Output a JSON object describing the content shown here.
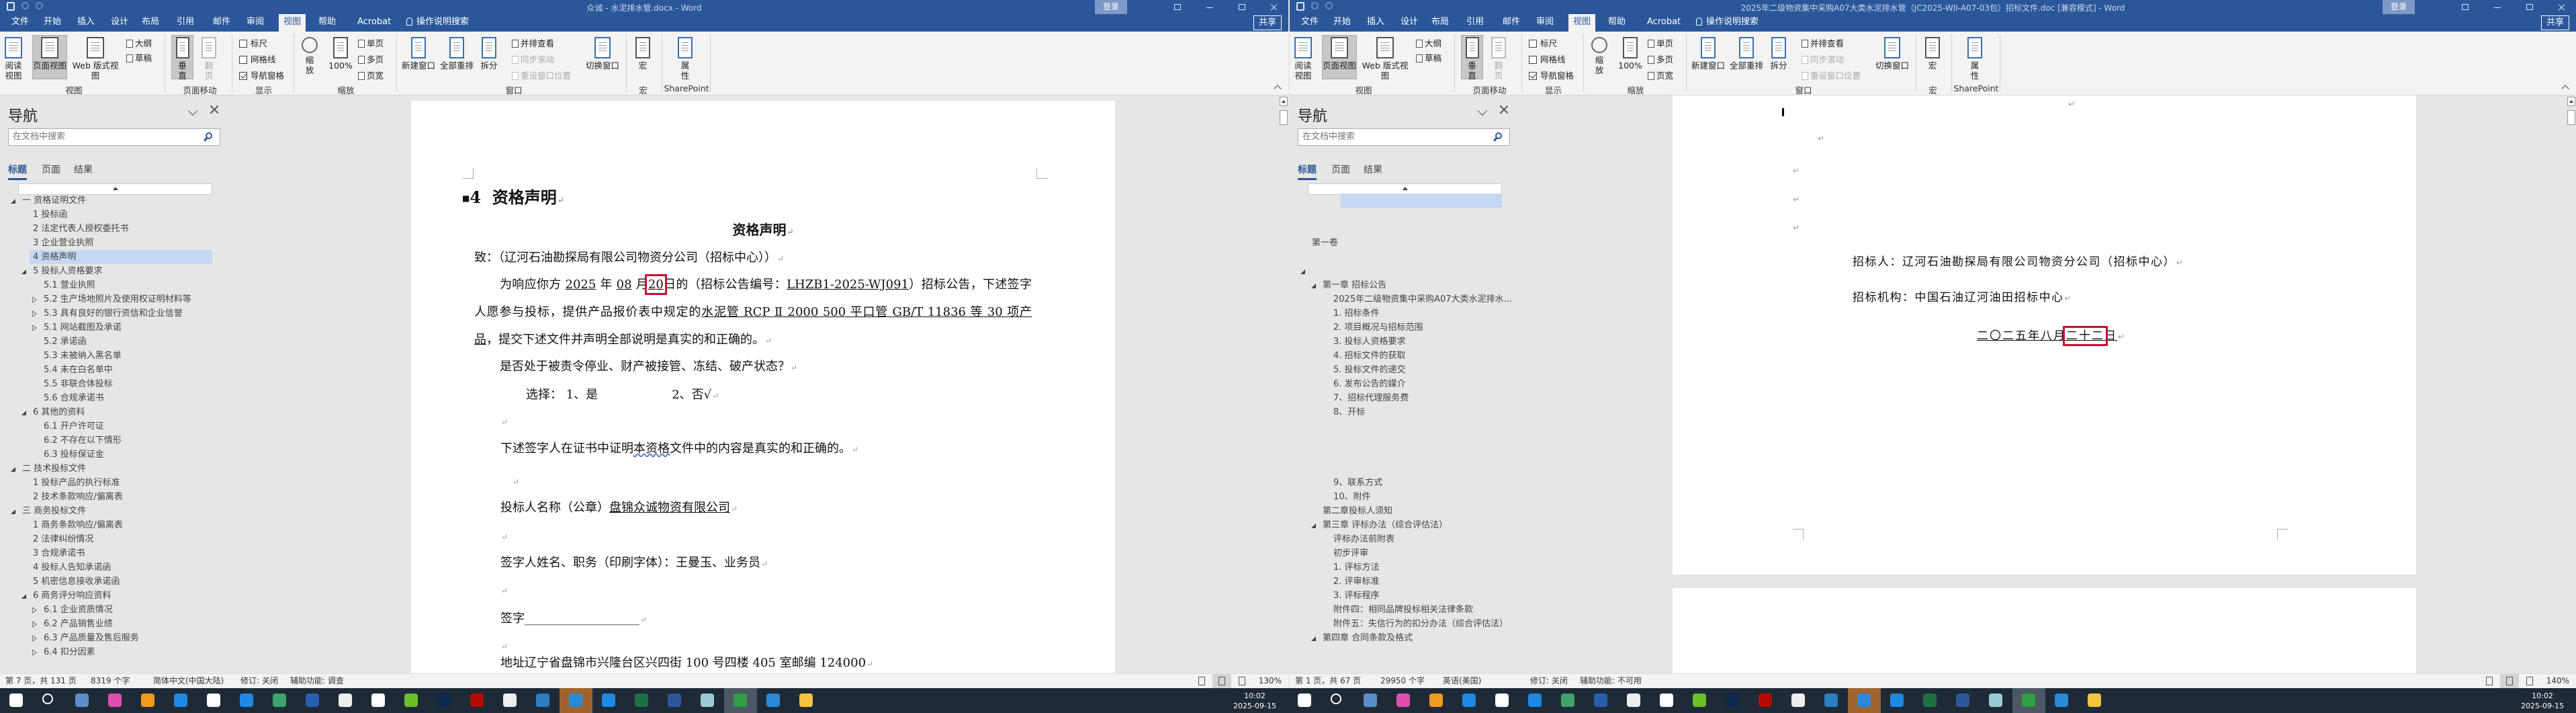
{
  "menu_tabs": [
    "文件",
    "开始",
    "插入",
    "设计",
    "布局",
    "引用",
    "邮件",
    "审阅",
    "视图",
    "帮助",
    "Acrobat"
  ],
  "active_tab": "视图",
  "tell_me": "操作说明搜索",
  "login": "登录",
  "share": "共享",
  "ribbon": {
    "read_mode": "阅读视图",
    "print_layout": "页面视图",
    "web_layout": "Web 版式视图",
    "outline": "大纲",
    "draft": "草稿",
    "vertical": "垂直",
    "side_to_side": "翻页",
    "ruler": "标尺",
    "gridlines": "网格线",
    "nav_pane": "导航窗格",
    "nav_pane_checked": true,
    "ruler_checked": false,
    "gridlines_checked": false,
    "zoom": "缩放",
    "zoom_100": "100%",
    "one_page": "单页",
    "multi_page": "多页",
    "page_width": "页宽",
    "new_window": "新建窗口",
    "arrange_all": "全部重排",
    "split": "拆分",
    "side_by_side": "并排查看",
    "sync_scroll": "同步滚动",
    "reset_position": "重设窗口位置",
    "switch_windows": "切换窗口",
    "macros": "宏",
    "properties": "属性",
    "groups": {
      "views": "视图",
      "page_movement": "页面移动",
      "show": "显示",
      "zoom": "缩放",
      "window": "窗口",
      "macros": "宏",
      "sharepoint": "SharePoint"
    }
  },
  "windows": [
    {
      "title": "众诚 - 水泥排水管.docx - Word",
      "nav": {
        "title": "导航",
        "search_placeholder": "在文档中搜索",
        "tabs": [
          "标题",
          "页面",
          "结果"
        ],
        "items": [
          {
            "label": "一 资格证明文件",
            "level": 0,
            "exp": "exp"
          },
          {
            "label": "1 投标函",
            "level": 1
          },
          {
            "label": "2 法定代表人授权委托书",
            "level": 1
          },
          {
            "label": "3 企业营业执照",
            "level": 1
          },
          {
            "label": "4 资格声明",
            "level": 1,
            "selected": true
          },
          {
            "label": "5 投标人资格要求",
            "level": 1,
            "exp": "exp"
          },
          {
            "label": "5.1 营业执照",
            "level": 2
          },
          {
            "label": "5.2 生产场地照片及使用权证明材料等",
            "level": 2,
            "exp": "col"
          },
          {
            "label": "5.3 具有良好的银行资信和企业信誉",
            "level": 2,
            "exp": "col"
          },
          {
            "label": "5.1 网站截图及承诺",
            "level": 2,
            "exp": "col"
          },
          {
            "label": "5.2 承诺函",
            "level": 2
          },
          {
            "label": "5.3 未被纳入黑名单",
            "level": 2
          },
          {
            "label": "5.4 未在白名单中",
            "level": 2
          },
          {
            "label": "5.5 非联合体投标",
            "level": 2
          },
          {
            "label": "5.6 合规承诺书",
            "level": 2
          },
          {
            "label": "6 其他的资料",
            "level": 1,
            "exp": "exp"
          },
          {
            "label": "6.1 开户许可证",
            "level": 2
          },
          {
            "label": "6.2 不存在以下情形",
            "level": 2
          },
          {
            "label": "6.3 投标保证金",
            "level": 2
          },
          {
            "label": "二 技术投标文件",
            "level": 0,
            "exp": "exp"
          },
          {
            "label": "1 投标产品的执行标准",
            "level": 1
          },
          {
            "label": "2 技术条款响应/偏离表",
            "level": 1
          },
          {
            "label": "三 商务投标文件",
            "level": 0,
            "exp": "exp"
          },
          {
            "label": "1 商务条款响应/偏离表",
            "level": 1
          },
          {
            "label": "2 法律纠纷情况",
            "level": 1
          },
          {
            "label": "3 合规承诺书",
            "level": 1
          },
          {
            "label": "4 投标人告知承诺函",
            "level": 1
          },
          {
            "label": "5 机密信息接收承诺函",
            "level": 1
          },
          {
            "label": "6 商务评分响应资料",
            "level": 1,
            "exp": "exp"
          },
          {
            "label": "6.1 企业资质情况",
            "level": 2,
            "exp": "col"
          },
          {
            "label": "6.2 产品销售业绩",
            "level": 2,
            "exp": "col"
          },
          {
            "label": "6.3 产品质量及售后服务",
            "level": 2,
            "exp": "col"
          },
          {
            "label": "6.4 扣分因素",
            "level": 2,
            "exp": "col"
          }
        ]
      },
      "status": {
        "page": "第 7 页，共 131 页",
        "words": "8319 个字",
        "lang": "简体中文(中国大陆)",
        "track": "修订: 关闭",
        "access": "辅助功能: 调查"
      },
      "zoom_level": "130%"
    },
    {
      "title": "2025年二级物资集中采购A07大类水泥排水管（JC2025-WII-A07-03包）招标文件.doc [兼容模式] - Word",
      "nav": {
        "title": "导航",
        "search_placeholder": "在文档中搜索",
        "tabs": [
          "标题",
          "页面",
          "结果"
        ],
        "items": [
          {
            "label": "",
            "level": 3,
            "selected": true
          },
          {
            "label": "",
            "level": 3
          },
          {
            "label": "",
            "level": 3
          },
          {
            "label": "第一卷",
            "level": 0
          },
          {
            "label": "",
            "level": 0
          },
          {
            "label": "",
            "level": 0,
            "exp": "exp"
          },
          {
            "label": "第一章  招标公告",
            "level": 1,
            "exp": "exp"
          },
          {
            "label": "2025年二级物资集中采购A07大类水泥排水...",
            "level": 2
          },
          {
            "label": "1. 招标条件",
            "level": 2
          },
          {
            "label": "2. 项目概况与招标范围",
            "level": 2
          },
          {
            "label": "3. 投标人资格要求",
            "level": 2
          },
          {
            "label": "4. 招标文件的获取",
            "level": 2
          },
          {
            "label": "5. 投标文件的递交",
            "level": 2
          },
          {
            "label": "6. 发布公告的媒介",
            "level": 2
          },
          {
            "label": "7、招标代理服务费",
            "level": 2
          },
          {
            "label": "8、开标",
            "level": 2
          },
          {
            "label": "",
            "level": 2
          },
          {
            "label": "",
            "level": 2
          },
          {
            "label": "",
            "level": 2
          },
          {
            "label": "",
            "level": 2
          },
          {
            "label": "9、联系方式",
            "level": 2
          },
          {
            "label": "10、附件",
            "level": 2
          },
          {
            "label": "第二章投标人须知",
            "level": 1
          },
          {
            "label": "第三章  评标办法（综合评估法）",
            "level": 1,
            "exp": "exp"
          },
          {
            "label": "评标办法前附表",
            "level": 2
          },
          {
            "label": "初步评审",
            "level": 2
          },
          {
            "label": "1. 评标方法",
            "level": 2
          },
          {
            "label": "2. 评审标准",
            "level": 2
          },
          {
            "label": "3. 评标程序",
            "level": 2
          },
          {
            "label": "附件四：相同品牌投标相关法律条款",
            "level": 2
          },
          {
            "label": "附件五：失信行为的扣分办法（综合评估法）",
            "level": 2
          },
          {
            "label": "第四章  合同条款及格式",
            "level": 1,
            "exp": "exp"
          }
        ]
      },
      "status": {
        "page": "第 1 页，共 67 页",
        "words": "29950 个字",
        "lang": "英语(美国)",
        "track": "修订: 关闭",
        "access": "辅助功能: 不可用"
      },
      "zoom_level": "140%"
    }
  ],
  "left_doc": {
    "heading_number": "4",
    "heading": "资格声明",
    "title": "资格声明",
    "to": "致：（辽河石油勘探局有限公司物资分公司（招标中心））",
    "p_intro": [
      "为响应你方 ",
      "2025",
      " 年 ",
      "08",
      " 月",
      "20",
      "日的（招标公告编号：",
      "LHZB1-2025-WJ091",
      "）招标公告，下述签字人愿参与投标，提供产品报价表中规定的",
      "水泥管 RCP Ⅱ 2000 500 平口管 GB/T 11836 等 30 项产品",
      "，提交下述文件并声明全部说明是真实的和正确的。"
    ],
    "question": "是否处于被责令停业、财产被接管、冻结、破产状态？",
    "choice_label": "选择： 1、是",
    "choice_no": "2、否√",
    "certify": [
      "下述签字人在证书中证明",
      "本资格",
      "文件中的内容是真实的和正确的。"
    ],
    "bidder_label": "投标人名称（公章）",
    "bidder_name": "盘锦众诚物资有限公司",
    "signer": "签字人姓名、职务（印刷字体）：王曼玉、业务员",
    "signature": "签字___________________",
    "address": "地址辽宁省盘锦市兴隆台区兴四街 100 号四楼 405 室邮编 124000"
  },
  "right_doc": {
    "tenderer": "招标人：辽河石油勘探局有限公司物资分公司（招标中心）",
    "agency": "招标机构：中国石油辽河油田招标中心",
    "date_prefix": "二〇二五年八月",
    "date_day": "二十二",
    "date_suffix": "日"
  },
  "taskbar": {
    "time": "10:02",
    "date": "2025-09-15",
    "icons": [
      {
        "name": "windows-start-icon",
        "color": "#ffffff"
      },
      {
        "name": "search-icon",
        "color": "#ffffff"
      },
      {
        "name": "calculator-icon",
        "color": "#5b8fc9"
      },
      {
        "name": "color-wheel-app-icon",
        "color": "#e04fb0"
      },
      {
        "name": "camera-app-icon",
        "color": "#f39a1e"
      },
      {
        "name": "dots-app-icon",
        "color": "#1e88e5"
      },
      {
        "name": "tencent-app-icon",
        "color": "#ffffff"
      },
      {
        "name": "browser-360-icon",
        "color": "#1e88e5"
      },
      {
        "name": "sync-app-icon",
        "color": "#3fa36b"
      },
      {
        "name": "ie-app-icon",
        "color": "#2a5db0"
      },
      {
        "name": "document-app-icon",
        "color": "#eeeeee"
      },
      {
        "name": "blank-file-icon",
        "color": "#ffffff"
      },
      {
        "name": "green-app-icon",
        "color": "#6bbf2a"
      },
      {
        "name": "photoshop-icon",
        "color": "#0a2a4d"
      },
      {
        "name": "acrobat-icon",
        "color": "#b30b00"
      },
      {
        "name": "qq-icon",
        "color": "#eeeeee"
      },
      {
        "name": "xiu-app-icon",
        "color": "#2a7fc1"
      },
      {
        "name": "orange-active-app-icon",
        "color": "#2a8ad8",
        "active": "active"
      },
      {
        "name": "blue-c-app-icon",
        "color": "#1e88e5"
      },
      {
        "name": "excel-icon",
        "color": "#1d7044"
      },
      {
        "name": "word-icon",
        "color": "#2b579a"
      },
      {
        "name": "glass-app-icon",
        "color": "#9cc9d9"
      },
      {
        "name": "green-s-app-icon",
        "color": "#2f9e44",
        "active": "active2"
      },
      {
        "name": "blue-doc-app-icon",
        "color": "#2a8ad8"
      },
      {
        "name": "file-explorer-icon",
        "color": "#f4c542"
      }
    ]
  }
}
